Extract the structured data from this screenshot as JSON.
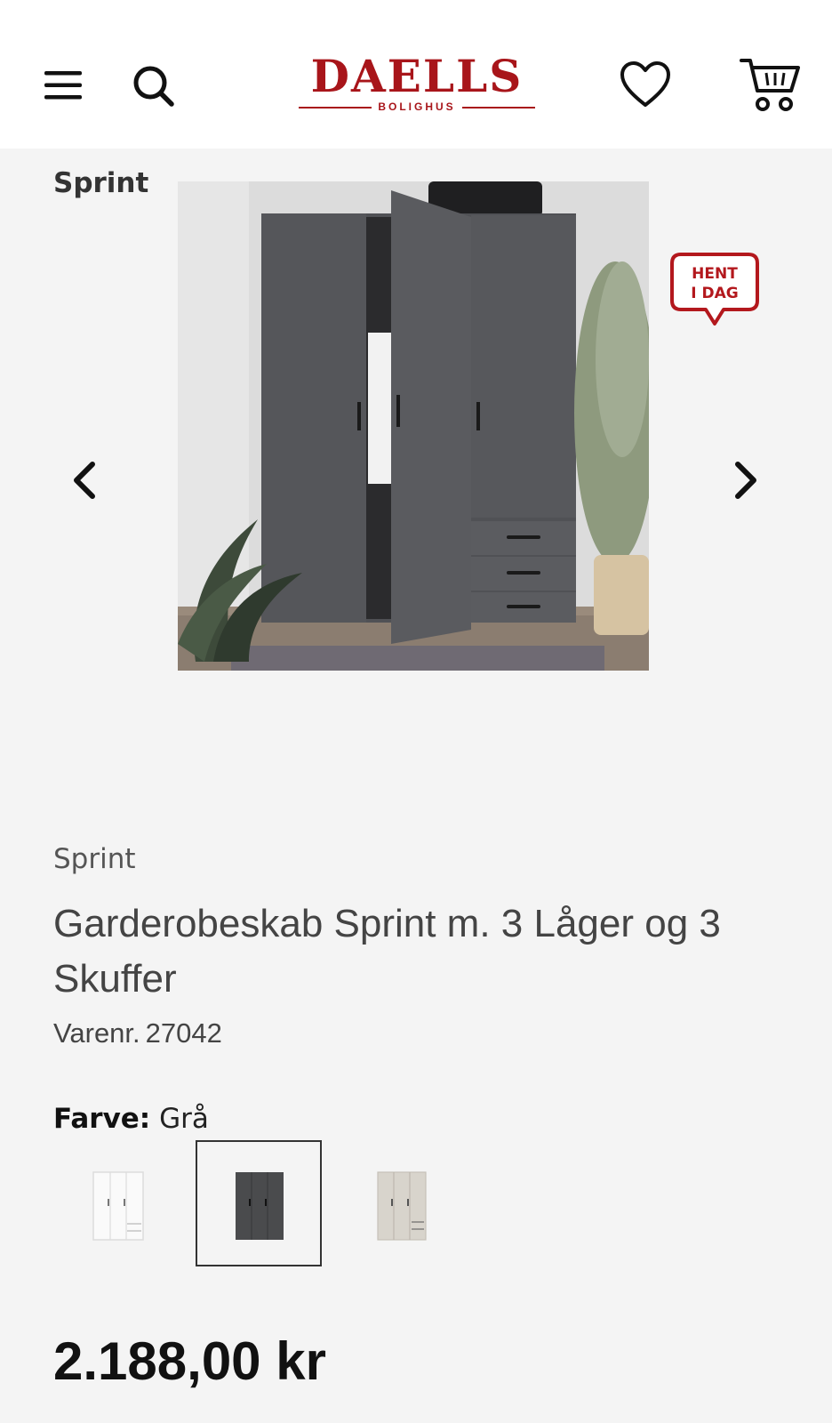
{
  "header": {
    "logo_main": "DAELLS",
    "logo_sub": "BOLIGHUS",
    "icons": [
      "menu-icon",
      "search-icon",
      "heart-icon",
      "cart-icon"
    ]
  },
  "gallery": {
    "brand_label": "Sprint",
    "badge": {
      "line1": "HENT",
      "line2": "I DAG"
    },
    "icons": [
      "chevron-left-icon",
      "chevron-right-icon"
    ]
  },
  "product": {
    "brand": "Sprint",
    "title": "Garderobeskab Sprint m. 3 Låger og 3 Skuffer",
    "sku_label": "Varenr.",
    "sku_value": "27042",
    "color_label": "Farve:",
    "color_value": "Grå",
    "price": "2.188,00 kr"
  },
  "swatches": [
    {
      "color": "#f7f7f7"
    },
    {
      "color": "#4a4b4d",
      "selected": true
    },
    {
      "color": "#d8d4cc"
    }
  ],
  "colors": {
    "brand_red": "#a8151a",
    "background": "#f4f4f4",
    "header_bg": "#ffffff",
    "wardrobe": "#55565a"
  }
}
